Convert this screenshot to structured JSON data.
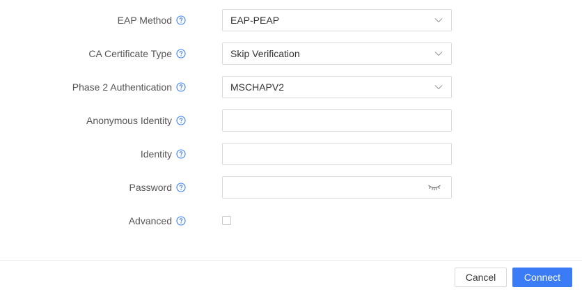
{
  "form": {
    "eap_method": {
      "label": "EAP Method",
      "value": "EAP-PEAP"
    },
    "ca_certificate_type": {
      "label": "CA Certificate Type",
      "value": "Skip Verification"
    },
    "phase2_authentication": {
      "label": "Phase 2 Authentication",
      "value": "MSCHAPV2"
    },
    "anonymous_identity": {
      "label": "Anonymous Identity",
      "value": ""
    },
    "identity": {
      "label": "Identity",
      "value": ""
    },
    "password": {
      "label": "Password",
      "value": ""
    },
    "advanced": {
      "label": "Advanced",
      "checked": false
    }
  },
  "footer": {
    "cancel_label": "Cancel",
    "connect_label": "Connect"
  },
  "icons": {
    "help": "help-circle-icon",
    "select_arrow": "chevron-down-icon",
    "password_toggle": "eye-closed-icon"
  },
  "colors": {
    "primary": "#3b7cf6",
    "help_icon": "#3b7cf6",
    "border": "#d9d9d9"
  }
}
